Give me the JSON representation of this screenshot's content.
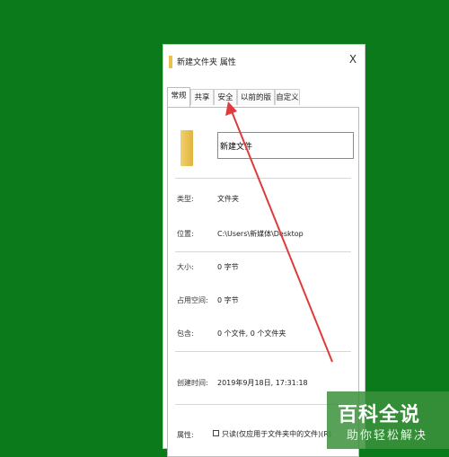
{
  "window": {
    "title": "新建文件夹 属性",
    "close_label": "X"
  },
  "tabs": [
    {
      "label": "常规",
      "active": true
    },
    {
      "label": "共享",
      "active": false
    },
    {
      "label": "安全",
      "active": false
    },
    {
      "label": "以前的版本",
      "active": false
    },
    {
      "label": "自定义",
      "active": false
    }
  ],
  "general": {
    "folder_name": "新建文件",
    "type_label": "类型:",
    "type_value": "文件夹",
    "location_label": "位置:",
    "location_value": "C:\\Users\\新媒体\\Desktop",
    "size_label": "大小:",
    "size_value": "0 字节",
    "disk_label": "占用空间:",
    "disk_value": "0 字节",
    "contains_label": "包含:",
    "contains_value": "0 个文件, 0 个文件夹",
    "created_label": "创建时间:",
    "created_value": "2019年9月18日, 17:31:18",
    "attr_label": "属性:",
    "readonly_label": "只读(仅应用于文件夹中的文件)(R)"
  },
  "annotation": {
    "color": "#e03a3a",
    "points_to": "安全"
  },
  "watermark": {
    "title": "百科全说",
    "subtitle": "助你轻松解决",
    "color": "#3c913c"
  }
}
